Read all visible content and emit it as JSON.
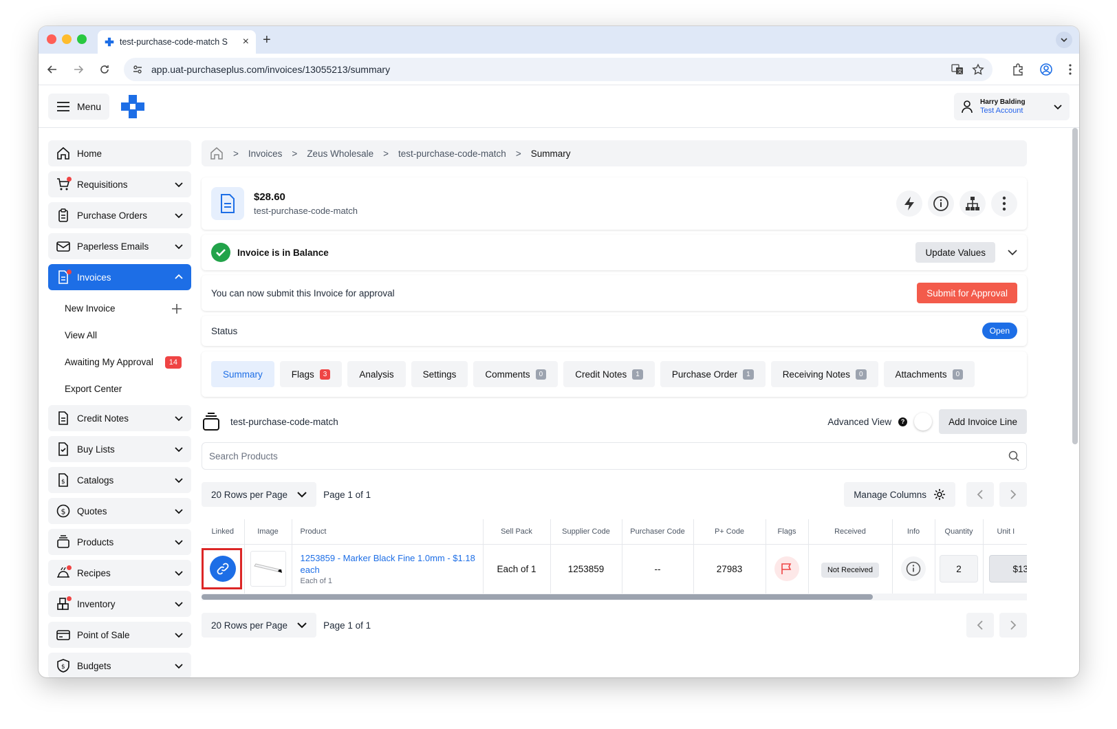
{
  "browser": {
    "tab_title": "test-purchase-code-match S",
    "url": "app.uat-purchaseplus.com/invoices/13055213/summary"
  },
  "header": {
    "menu_label": "Menu",
    "user_name": "Harry Balding",
    "account": "Test Account"
  },
  "sidebar": {
    "items": [
      {
        "label": "Home"
      },
      {
        "label": "Requisitions"
      },
      {
        "label": "Purchase Orders"
      },
      {
        "label": "Paperless Emails"
      },
      {
        "label": "Invoices"
      },
      {
        "label": "Credit Notes"
      },
      {
        "label": "Buy Lists"
      },
      {
        "label": "Catalogs"
      },
      {
        "label": "Quotes"
      },
      {
        "label": "Products"
      },
      {
        "label": "Recipes"
      },
      {
        "label": "Inventory"
      },
      {
        "label": "Point of Sale"
      },
      {
        "label": "Budgets"
      }
    ],
    "invoice_sub": {
      "new_invoice": "New Invoice",
      "view_all": "View All",
      "awaiting": "Awaiting My Approval",
      "awaiting_count": "14",
      "export": "Export Center"
    }
  },
  "breadcrumb": {
    "c1": "Invoices",
    "c2": "Zeus Wholesale",
    "c3": "test-purchase-code-match",
    "c4": "Summary"
  },
  "invoice": {
    "amount": "$28.60",
    "name": "test-purchase-code-match",
    "balance_label": "Invoice is in Balance",
    "update_values": "Update Values",
    "submit_text": "You can now submit this Invoice for approval",
    "submit_button": "Submit for Approval",
    "status_label": "Status",
    "status_value": "Open"
  },
  "tabs": [
    {
      "label": "Summary"
    },
    {
      "label": "Flags",
      "count": "3"
    },
    {
      "label": "Analysis"
    },
    {
      "label": "Settings"
    },
    {
      "label": "Comments",
      "count": "0"
    },
    {
      "label": "Credit Notes",
      "count": "1"
    },
    {
      "label": "Purchase Order",
      "count": "1"
    },
    {
      "label": "Receiving Notes",
      "count": "0"
    },
    {
      "label": "Attachments",
      "count": "0"
    }
  ],
  "lines": {
    "title": "test-purchase-code-match",
    "advanced_view": "Advanced View",
    "help": "?",
    "add_line": "Add Invoice Line",
    "search_placeholder": "Search Products",
    "rows_per_page": "20 Rows per Page",
    "page_info": "Page 1 of 1",
    "manage_columns": "Manage Columns"
  },
  "table": {
    "headers": [
      "Linked",
      "Image",
      "Product",
      "Sell Pack",
      "Supplier Code",
      "Purchaser Code",
      "P+ Code",
      "Flags",
      "Received",
      "Info",
      "Quantity",
      "Unit I"
    ],
    "row": {
      "product": "1253859 - Marker Black Fine 1.0mm - $1.18 each",
      "product_sub": "Each of 1",
      "sell_pack": "Each of 1",
      "supplier_code": "1253859",
      "purchaser_code": "--",
      "pplus_code": "27983",
      "received": "Not Received",
      "quantity": "2",
      "unit": "$13."
    }
  },
  "colors": {
    "brand": "#1d6ee6",
    "danger": "#f35b4b",
    "success": "#22a34a"
  }
}
